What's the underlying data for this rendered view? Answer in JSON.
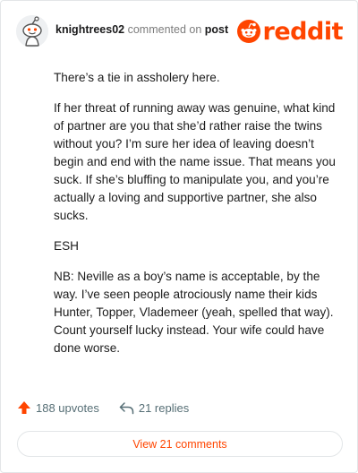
{
  "header": {
    "username": "knightrees02",
    "action": "commented on",
    "target": "post",
    "brand": "reddit"
  },
  "comment": {
    "paragraphs": [
      "There’s a tie in assholery here.",
      "If her threat of running away was genuine, what kind of partner are you that she’d rather raise the twins without you? I’m sure her idea of leaving doesn’t begin and end with the name issue. That means you suck. If she’s bluffing to manipulate you, and you’re actually a loving and supportive partner, she also sucks.",
      "ESH",
      "NB: Neville as a boy’s name is acceptable, by the way. I’ve seen people atrociously name their kids Hunter, Topper, Vlademeer (yeah, spelled that way). Count yourself lucky instead. Your wife could have done worse."
    ]
  },
  "stats": {
    "upvotes": "188 upvotes",
    "replies": "21 replies"
  },
  "footer": {
    "view_label": "View 21 comments"
  },
  "colors": {
    "accent": "#ff4500",
    "muted": "#576f76",
    "border": "#e3e6e8"
  }
}
